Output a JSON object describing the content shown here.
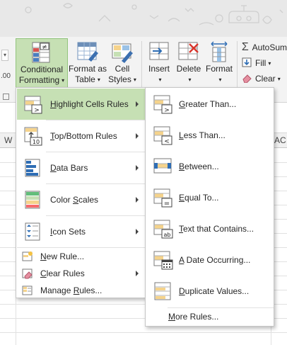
{
  "ribbon": {
    "left_stub": {
      "dropdown_glyph": "▾",
      "number_fragment": ".00"
    },
    "conditional_formatting": {
      "line1": "Conditional",
      "line2": "Formatting",
      "caret": "▾"
    },
    "format_as_table": {
      "line1": "Format as",
      "line2": "Table",
      "caret": "▾"
    },
    "cell_styles": {
      "line1": "Cell",
      "line2": "Styles",
      "caret": "▾"
    },
    "insert": {
      "line1": "Insert",
      "caret": "▾"
    },
    "delete": {
      "line1": "Delete",
      "caret": "▾"
    },
    "format": {
      "line1": "Format",
      "caret": "▾"
    },
    "editing": {
      "autosum": {
        "label": "AutoSum",
        "icon": "Σ"
      },
      "fill": {
        "label": "Fill",
        "caret": "▾"
      },
      "clear": {
        "label": "Clear",
        "caret": "▾"
      }
    }
  },
  "grid": {
    "columns": [
      "W",
      "AC"
    ]
  },
  "menu": {
    "items": [
      {
        "pre": "",
        "key": "H",
        "post": "ighlight Cells Rules",
        "icon": "highlight-cells-icon"
      },
      {
        "pre": "",
        "key": "T",
        "post": "op/Bottom Rules",
        "icon": "top-bottom-icon"
      },
      {
        "pre": "",
        "key": "D",
        "post": "ata Bars",
        "icon": "data-bars-icon"
      },
      {
        "pre": "Color ",
        "key": "S",
        "post": "cales",
        "icon": "color-scales-icon"
      },
      {
        "pre": "",
        "key": "I",
        "post": "con Sets",
        "icon": "icon-sets-icon"
      }
    ],
    "small_items": [
      {
        "pre": "",
        "key": "N",
        "post": "ew Rule...",
        "icon": "new-rule-icon"
      },
      {
        "pre": "",
        "key": "C",
        "post": "lear Rules",
        "icon": "clear-rules-icon"
      },
      {
        "pre": "Manage ",
        "key": "R",
        "post": "ules...",
        "icon": "manage-rules-icon"
      }
    ]
  },
  "submenu": {
    "items": [
      {
        "pre": "",
        "key": "G",
        "post": "reater Than...",
        "icon": "greater-than-icon",
        "symbol": ">"
      },
      {
        "pre": "",
        "key": "L",
        "post": "ess Than...",
        "icon": "less-than-icon",
        "symbol": "<"
      },
      {
        "pre": "",
        "key": "B",
        "post": "etween...",
        "icon": "between-icon",
        "symbol": ""
      },
      {
        "pre": "",
        "key": "E",
        "post": "qual To...",
        "icon": "equal-to-icon",
        "symbol": "="
      },
      {
        "pre": "",
        "key": "T",
        "post": "ext that Contains...",
        "icon": "text-contains-icon",
        "symbol": "ab"
      },
      {
        "pre": "",
        "key": "A",
        "post": " Date Occurring...",
        "icon": "date-occurring-icon",
        "symbol": ""
      },
      {
        "pre": "",
        "key": "D",
        "post": "uplicate Values...",
        "icon": "duplicate-values-icon",
        "symbol": ""
      }
    ],
    "more": {
      "pre": "",
      "key": "M",
      "post": "ore Rules..."
    }
  },
  "colors": {
    "accent_green": "#c6e0b4",
    "accent_border": "#92c47d",
    "cell_highlight": "#f5d38c"
  }
}
